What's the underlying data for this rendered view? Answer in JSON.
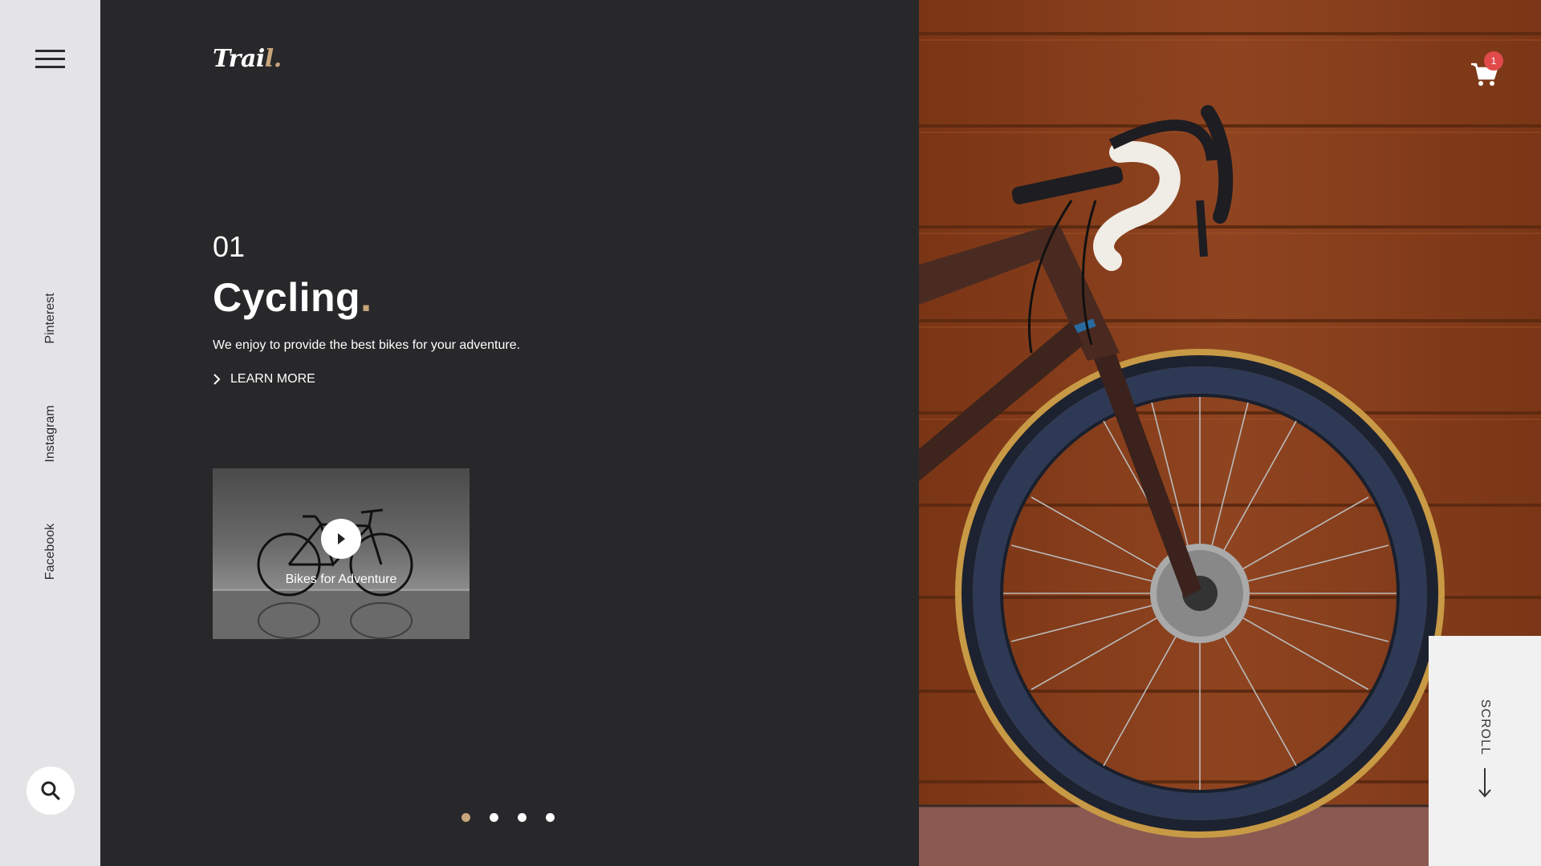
{
  "brand": {
    "logo_main": "Trai",
    "logo_accent": "l."
  },
  "sidebar": {
    "menu_icon": "hamburger-menu-icon",
    "social": [
      "Pinterest",
      "Instagram",
      "Facebook"
    ],
    "search_icon": "search-icon"
  },
  "slide": {
    "number": "01",
    "title": "Cycling",
    "title_dot": ".",
    "description": "We enjoy to provide the best bikes for your adventure.",
    "cta": "LEARN MORE"
  },
  "video": {
    "caption": "Bikes for Adventure",
    "play_icon": "play-icon"
  },
  "pagination": {
    "count": 4,
    "active": 1
  },
  "cart": {
    "icon": "shopping-cart-icon",
    "badge": "1"
  },
  "scroll": {
    "label": "SCROLL",
    "icon": "arrow-down-icon"
  },
  "colors": {
    "accent": "#c9a57c",
    "dark": "#28282a",
    "sidebar": "#e4e4e6",
    "badge": "#e04a4a"
  }
}
